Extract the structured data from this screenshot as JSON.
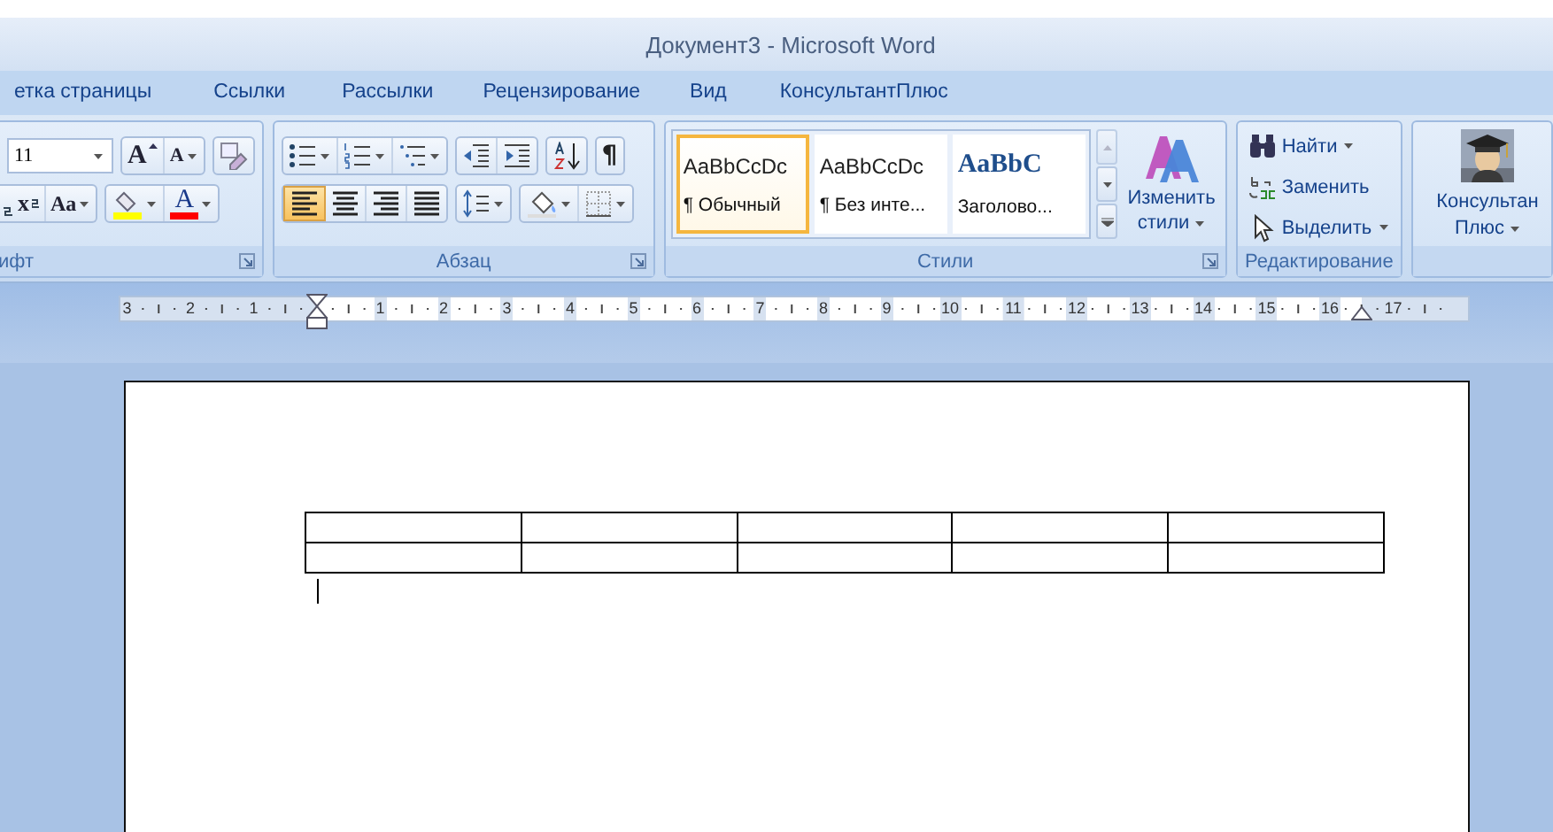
{
  "window": {
    "title": "Документ3 - Microsoft Word"
  },
  "tabs": [
    {
      "label": "етка страницы",
      "selected": false
    },
    {
      "label": "Ссылки",
      "selected": false
    },
    {
      "label": "Рассылки",
      "selected": false
    },
    {
      "label": "Рецензирование",
      "selected": false
    },
    {
      "label": "Вид",
      "selected": false
    },
    {
      "label": "КонсультантПлюс",
      "selected": false
    }
  ],
  "font_group": {
    "label": "ифт",
    "font_size": "11",
    "grow": "A",
    "shrink": "A",
    "superscript": "x",
    "change_case": "Aa",
    "font_color_letter": "A"
  },
  "paragraph_group": {
    "label": "Абзац",
    "pilcrow": "¶",
    "alignments": [
      {
        "kind": "left",
        "selected": true
      },
      {
        "kind": "center",
        "selected": false
      },
      {
        "kind": "right",
        "selected": false
      },
      {
        "kind": "justify",
        "selected": false
      }
    ]
  },
  "styles_group": {
    "label": "Стили",
    "gallery": [
      {
        "preview": "AaBbCcDc",
        "name": "¶ Обычный",
        "kind": "normal",
        "selected": true
      },
      {
        "preview": "AaBbCcDc",
        "name": "¶ Без инте...",
        "kind": "normal",
        "selected": false
      },
      {
        "preview": "AaBbC",
        "name": "Заголово...",
        "kind": "heading",
        "selected": false
      }
    ],
    "change_styles": [
      "Изменить",
      "стили"
    ]
  },
  "editing_group": {
    "label": "Редактирование",
    "items": [
      {
        "kind": "find",
        "label": "Найти",
        "dropdown": true
      },
      {
        "kind": "replace",
        "label": "Заменить",
        "dropdown": false
      },
      {
        "kind": "select",
        "label": "Выделить",
        "dropdown": true
      }
    ]
  },
  "consultant_group": {
    "lines": [
      "Консультан",
      "Плюс"
    ]
  },
  "ruler": {
    "left_labels": [
      "3",
      "2",
      "1"
    ],
    "right_labels": [
      "1",
      "2",
      "3",
      "4",
      "5",
      "6",
      "7",
      "8",
      "9",
      "10",
      "11",
      "12",
      "13",
      "14",
      "15",
      "16",
      "17"
    ]
  },
  "document": {
    "table": {
      "rows": [
        [
          "",
          "",
          "",
          "",
          ""
        ],
        [
          "",
          "",
          "",
          "",
          ""
        ]
      ]
    }
  }
}
